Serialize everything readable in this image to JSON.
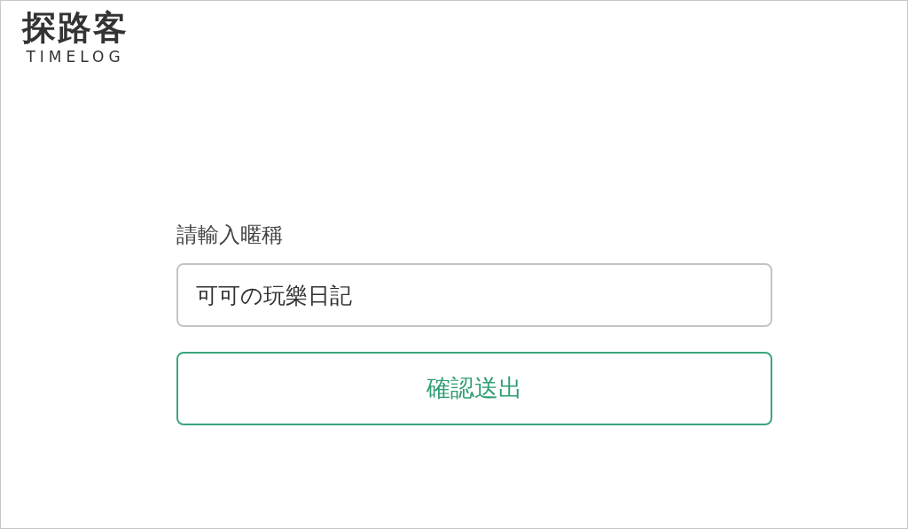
{
  "logo": {
    "name": "探路客",
    "subtitle": "TIMELOG"
  },
  "form": {
    "label": "請輸入暱稱",
    "nickname": {
      "value": "可可の玩樂日記"
    },
    "submit": "確認送出"
  }
}
